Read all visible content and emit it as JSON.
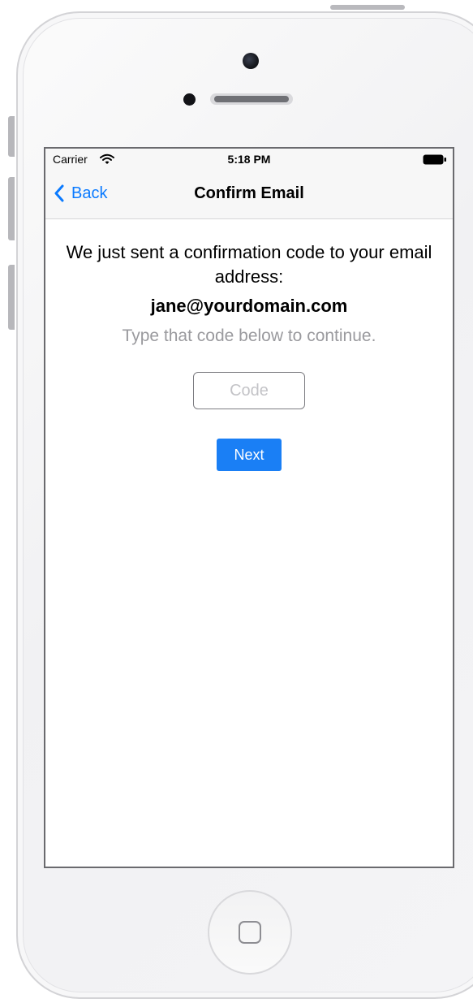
{
  "status_bar": {
    "carrier": "Carrier",
    "time": "5:18 PM",
    "icons": [
      "wifi-icon",
      "battery-icon"
    ]
  },
  "nav_bar": {
    "back_label": "Back",
    "title": "Confirm Email",
    "back_icon": "chevron-left-icon"
  },
  "content": {
    "message": "We just sent a confirmation code to your email address:",
    "email": "jane@yourdomain.com",
    "instruction": "Type that code below to continue.",
    "code_field": {
      "value": "",
      "placeholder": "Code"
    },
    "next_label": "Next"
  },
  "device": {
    "home_icon": "home-square-icon"
  },
  "colors": {
    "accent": "#0a7aff",
    "button": "#1a7ff5",
    "muted_text": "#9a9a9e"
  }
}
